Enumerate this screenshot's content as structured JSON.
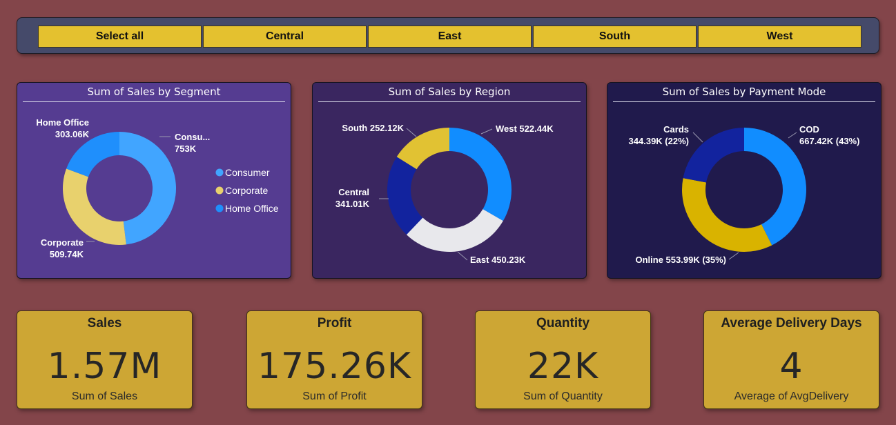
{
  "slicer": {
    "items": [
      "Select all",
      "Central",
      "East",
      "South",
      "West"
    ]
  },
  "charts_style": {
    "segment_bg": "#553c91",
    "region_bg": "#3a2660",
    "payment_bg": "#201a4c"
  },
  "chart_data": [
    {
      "type": "pie",
      "title": "Sum of Sales by Segment",
      "categories": [
        "Consumer",
        "Corporate",
        "Home Office"
      ],
      "values": [
        753000,
        509740,
        303060
      ],
      "data_labels": [
        [
          "Consu...",
          "753K"
        ],
        [
          "Corporate",
          "509.74K"
        ],
        [
          "Home Office",
          "303.06K"
        ]
      ],
      "colors": [
        "#41a5ff",
        "#e8d16d",
        "#1f8ffc"
      ],
      "legend": [
        "Consumer",
        "Corporate",
        "Home Office"
      ],
      "legend_position": "right"
    },
    {
      "type": "pie",
      "title": "Sum of Sales by Region",
      "categories": [
        "West",
        "East",
        "Central",
        "South"
      ],
      "values": [
        522440,
        450230,
        341010,
        252120
      ],
      "data_labels": [
        [
          "West 522.44K"
        ],
        [
          "East 450.23K"
        ],
        [
          "Central",
          "341.01K"
        ],
        [
          "South 252.12K"
        ]
      ],
      "colors": [
        "#118dff",
        "#e8e8ec",
        "#12239e",
        "#e1c233"
      ]
    },
    {
      "type": "pie",
      "title": "Sum of Sales by Payment Mode",
      "categories": [
        "COD",
        "Online",
        "Cards"
      ],
      "values": [
        667420,
        553990,
        344390
      ],
      "data_labels": [
        [
          "COD",
          "667.42K (43%)"
        ],
        [
          "Online 553.99K (35%)"
        ],
        [
          "Cards",
          "344.39K (22%)"
        ]
      ],
      "colors": [
        "#118dff",
        "#d9b300",
        "#12239e"
      ]
    }
  ],
  "kpis": [
    {
      "title": "Sales",
      "value": "1.57M",
      "subtitle": "Sum of Sales"
    },
    {
      "title": "Profit",
      "value": "175.26K",
      "subtitle": "Sum of Profit"
    },
    {
      "title": "Quantity",
      "value": "22K",
      "subtitle": "Sum of Quantity"
    },
    {
      "title": "Average Delivery Days",
      "value": "4",
      "subtitle": "Average of AvgDelivery"
    }
  ]
}
